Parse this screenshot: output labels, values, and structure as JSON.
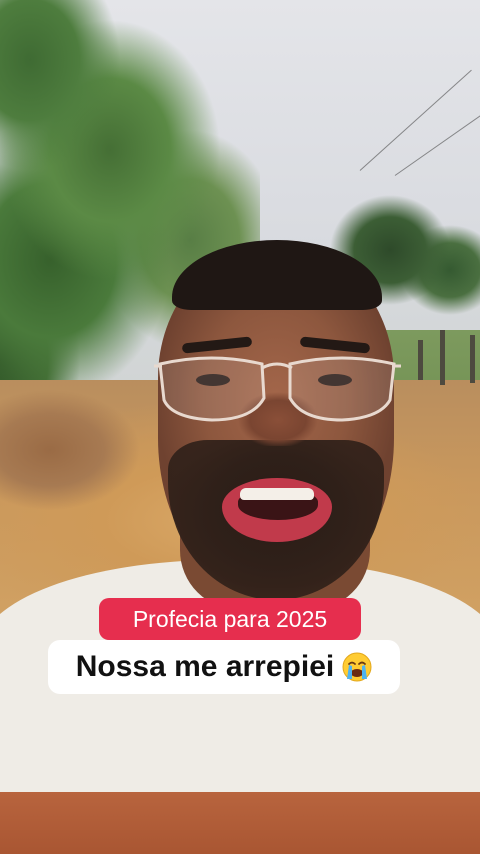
{
  "captions": {
    "top": "Profecia para 2025",
    "bottom": "Nossa me arrepiei",
    "bottom_emoji": "loudly-crying-face-icon"
  },
  "colors": {
    "caption_top_bg": "#e62e4e",
    "caption_top_text": "#ffffff",
    "caption_bottom_bg": "#ffffff",
    "caption_bottom_text": "#111111"
  }
}
